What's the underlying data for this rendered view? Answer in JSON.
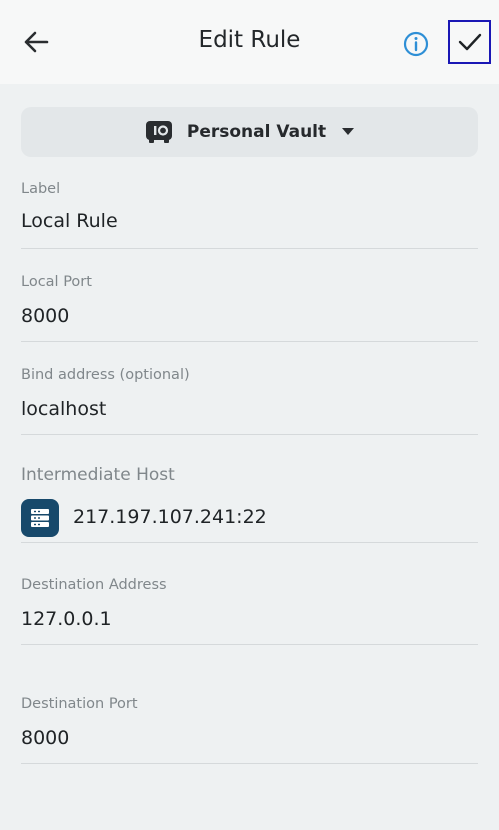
{
  "header": {
    "title": "Edit Rule",
    "back_icon": "arrow-left-icon",
    "info_icon": "info-circle-icon",
    "save_icon": "checkmark-icon",
    "accent_color": "#2e8fd6",
    "focus_outline_color": "#1a17b5"
  },
  "vault": {
    "label": "Personal Vault",
    "icon": "vault-icon",
    "dropdown_icon": "caret-down-icon"
  },
  "fields": {
    "label": {
      "label": "Label",
      "value": "Local Rule"
    },
    "local_port": {
      "label": "Local Port",
      "value": "8000"
    },
    "bind_address": {
      "label": "Bind address (optional)",
      "value": "localhost"
    },
    "intermediate_host": {
      "label": "Intermediate Host",
      "value": "217.197.107.241:22",
      "icon": "server-icon",
      "icon_color": "#17496b"
    },
    "destination_address": {
      "label": "Destination Address",
      "value": "127.0.0.1"
    },
    "destination_port": {
      "label": "Destination Port",
      "value": "8000"
    }
  }
}
